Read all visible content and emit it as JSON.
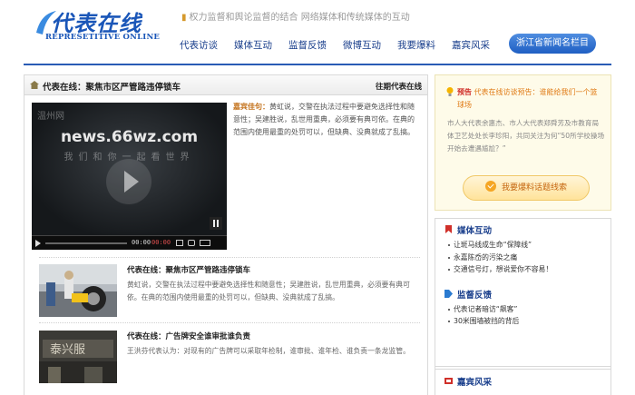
{
  "header": {
    "logo_cn": "代表在线",
    "logo_en": "REPRESETITIVE ONLINE",
    "slogan": "权力监督和舆论监督的结合  网络媒体和传统媒体的互动",
    "nav": [
      "代表访谈",
      "媒体互动",
      "监督反馈",
      "微博互动",
      "我要爆料",
      "嘉宾风采"
    ],
    "nav_button": "浙江省新闻名栏目"
  },
  "main": {
    "title": "代表在线：聚焦市区严管路违停锁车",
    "more_link": "往期代表在线",
    "video": {
      "watermark": "温州网",
      "url_text": "news.66wz.com",
      "sub_text": "我们和你一起看世界",
      "time_current": "00:00",
      "time_total": "00:00"
    },
    "lead": {
      "tag": "嘉宾佳句：",
      "text": "黄虹说，交警在执法过程中要避免选择性和随意性；吴建胜说，乱世用重典，必须要有典可依。在典的范围内使用最重的处罚可以，但缺典、没典就成了乱搞。"
    },
    "news": [
      {
        "title": "代表在线：聚焦市区严管路违停锁车",
        "desc": "黄虹说，交警在执法过程中要避免选择性和随意性；吴建胜说，乱世用重典，必须要有典可依。在典的范围内使用最重的处罚可以，但缺典、没典就成了乱搞。"
      },
      {
        "title": "代表在线：广告牌安全谁审批谁负责",
        "desc": "王洪芬代表认为：对现有的广告牌可以采取年检制，谁审批、谁年检、谁负责一条龙监管。",
        "sign_text": "泰兴服"
      }
    ]
  },
  "side": {
    "notice": {
      "prefix": "预告",
      "title": "代表在线访谈预告：谁能给我们一个篮球场",
      "desc": "市人大代表余惠杰、市人大代表郑舜芳及市教育局体卫艺处处长李珍阳，共同关注为何“50所学校操场开始去遭遇尴尬？”",
      "button": "我要爆料话题线索"
    },
    "media": {
      "title": "媒体互动",
      "items": [
        "让斑马线成生命“保障线”",
        "永嘉陈岙的污染之痛",
        "交通信号灯，想说爱你不容易！"
      ]
    },
    "feedback": {
      "title": "监督反馈",
      "items": [
        "代表记者暗访“飙客”",
        "30米围墙被挡的背后"
      ]
    },
    "guests": {
      "title": "嘉宾风采"
    }
  },
  "colors": {
    "brand_blue": "#1a56b8",
    "nav_blue": "#1a3f8c",
    "accent_orange": "#e07b16",
    "accent_red": "#d0302a"
  }
}
